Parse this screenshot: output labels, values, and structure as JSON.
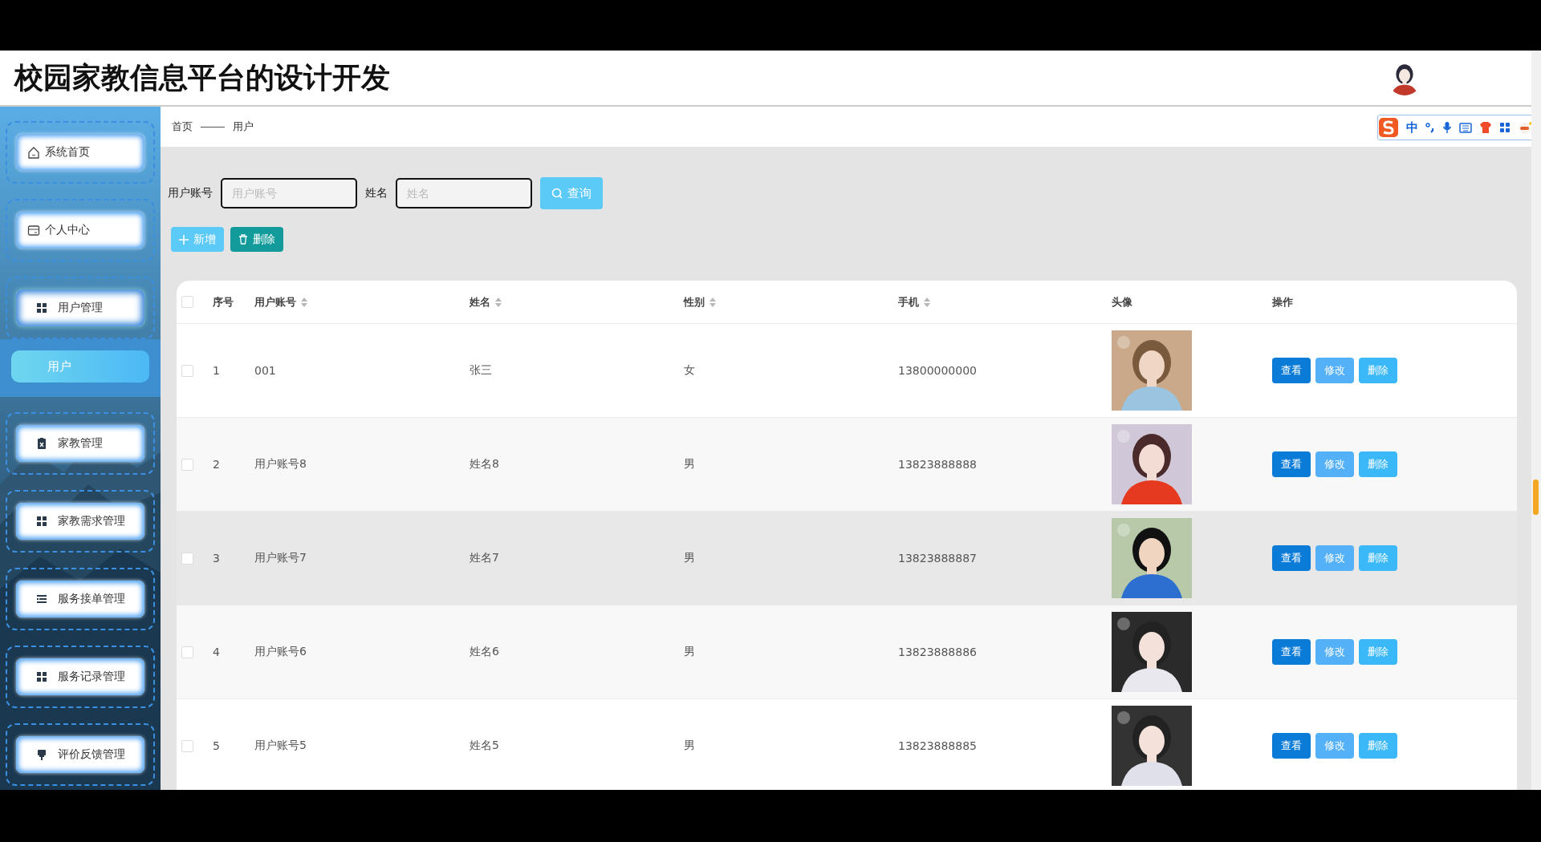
{
  "header": {
    "title": "校园家教信息平台的设计开发"
  },
  "ime_toolbar": {
    "mode": "中"
  },
  "sidebar": {
    "items": [
      {
        "label": "系统首页",
        "expanded": false
      },
      {
        "label": "个人中心",
        "expanded": false
      },
      {
        "label": "用户管理",
        "expanded": true,
        "children": [
          {
            "label": "用户",
            "selected": true
          }
        ]
      },
      {
        "label": "家教管理",
        "expanded": false
      },
      {
        "label": "家教需求管理",
        "expanded": false
      },
      {
        "label": "服务接单管理",
        "expanded": false
      },
      {
        "label": "服务记录管理",
        "expanded": false
      },
      {
        "label": "评价反馈管理",
        "expanded": false
      }
    ]
  },
  "breadcrumb": [
    "首页",
    "用户"
  ],
  "search": {
    "fields": [
      {
        "label": "用户账号",
        "placeholder": "用户账号"
      },
      {
        "label": "姓名",
        "placeholder": "姓名"
      }
    ],
    "button": "查询"
  },
  "actions": [
    {
      "label": "新增",
      "kind": "add"
    },
    {
      "label": "删除",
      "kind": "delete"
    }
  ],
  "table": {
    "columns": [
      {
        "label": "序号",
        "sortable": false
      },
      {
        "label": "用户账号",
        "sortable": true
      },
      {
        "label": "姓名",
        "sortable": true
      },
      {
        "label": "性别",
        "sortable": true
      },
      {
        "label": "手机",
        "sortable": true
      },
      {
        "label": "头像",
        "sortable": false
      },
      {
        "label": "操作",
        "sortable": false
      }
    ],
    "header_checked": false,
    "rows": [
      {
        "checked": false,
        "hovered": false,
        "cells": [
          "1",
          "001",
          "张三",
          "女",
          "13800000000"
        ],
        "buttons": [
          "查看",
          "修改",
          "删除"
        ]
      },
      {
        "checked": false,
        "hovered": false,
        "cells": [
          "2",
          "用户账号8",
          "姓名8",
          "男",
          "13823888888"
        ],
        "buttons": [
          "查看",
          "修改",
          "删除"
        ]
      },
      {
        "checked": false,
        "hovered": true,
        "cells": [
          "3",
          "用户账号7",
          "姓名7",
          "男",
          "13823888887"
        ],
        "buttons": [
          "查看",
          "修改",
          "删除"
        ]
      },
      {
        "checked": false,
        "hovered": false,
        "cells": [
          "4",
          "用户账号6",
          "姓名6",
          "男",
          "13823888886"
        ],
        "buttons": [
          "查看",
          "修改",
          "删除"
        ]
      },
      {
        "checked": false,
        "hovered": false,
        "cells": [
          "5",
          "用户账号5",
          "姓名5",
          "男",
          "13823888885"
        ],
        "buttons": [
          "查看",
          "修改",
          "删除"
        ]
      }
    ]
  }
}
